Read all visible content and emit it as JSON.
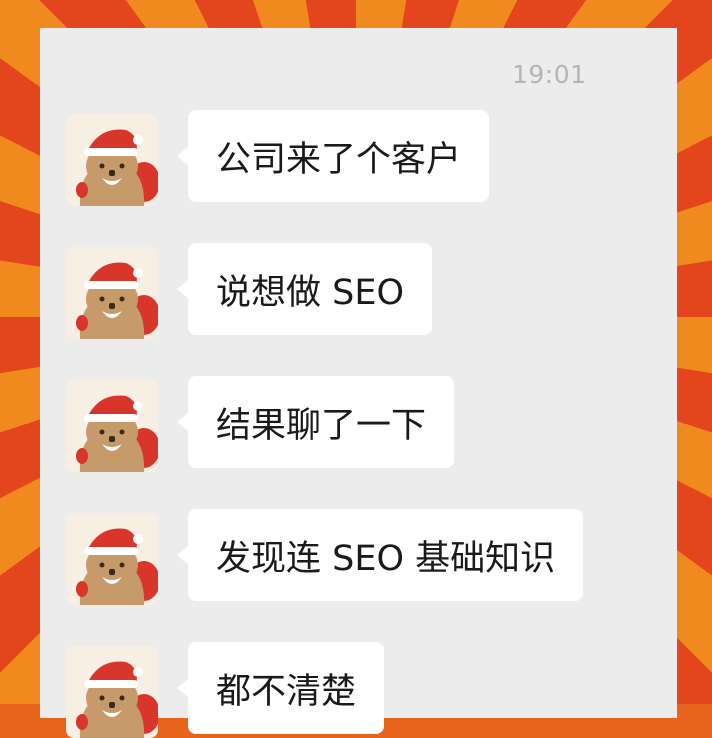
{
  "chat": {
    "time": "19:01",
    "messages": [
      {
        "text": "公司来了个客户",
        "avatar": "capybara-santa-avatar"
      },
      {
        "text": "说想做 SEO",
        "avatar": "capybara-santa-avatar"
      },
      {
        "text": "结果聊了一下",
        "avatar": "capybara-santa-avatar"
      },
      {
        "text": "发现连 SEO 基础知识",
        "avatar": "capybara-santa-avatar"
      },
      {
        "text": "都不清楚",
        "avatar": "capybara-santa-avatar"
      }
    ]
  },
  "colors": {
    "bubble": "#ffffff",
    "chat_background": "#ececec",
    "timestamp": "#b4b4b4",
    "frame_orange": "#f08a1e",
    "frame_red": "#e3451c"
  }
}
